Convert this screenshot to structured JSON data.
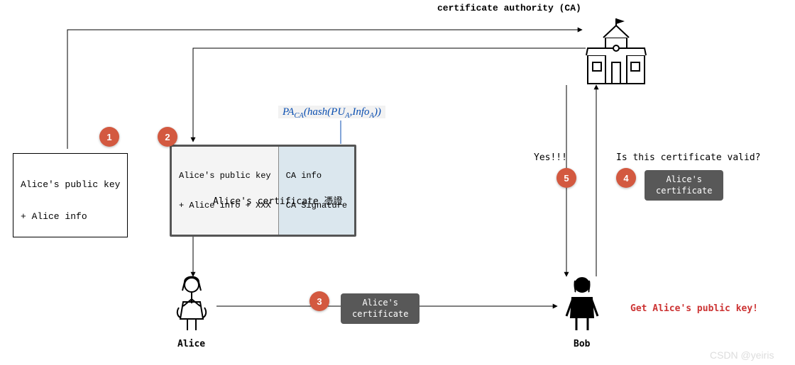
{
  "title": "certificate authority (CA)",
  "steps": {
    "s1": "1",
    "s2": "2",
    "s3": "3",
    "s4": "4",
    "s5": "5"
  },
  "box1": {
    "line1": "Alice's public key",
    "line2": "+ Alice info"
  },
  "cert": {
    "left_l1": "Alice's public key",
    "left_l2": "+ Alice info + XXX",
    "right_l1": "CA info",
    "right_l2": "CA Signature"
  },
  "formula": {
    "pa": "PA",
    "ca": "CA",
    "hash": "hash",
    "pu": "PU",
    "a": "A",
    "info": "Info"
  },
  "cert_caption": "Alice's certificate 憑證",
  "cert_chip3": "Alice's\ncertificate",
  "cert_chip4": "Alice's\ncertificate",
  "yes": "Yes!!!",
  "question": "Is this certificate valid?",
  "alice": "Alice",
  "bob": "Bob",
  "result": "Get Alice's public key!",
  "watermark": "CSDN @yeiris"
}
